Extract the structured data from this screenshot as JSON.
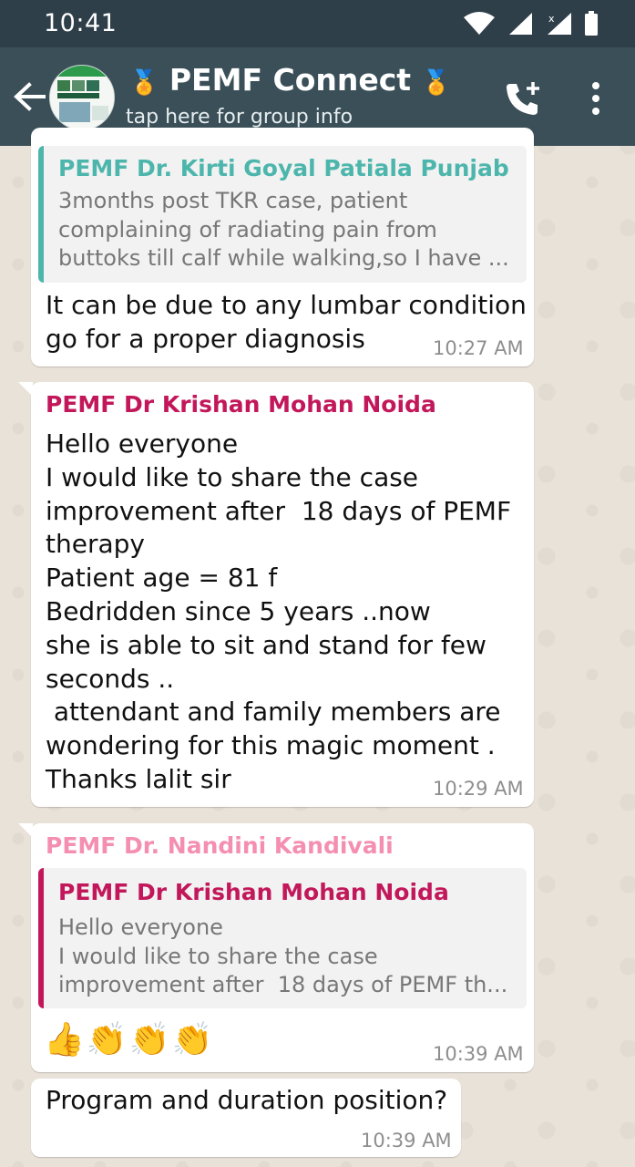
{
  "status_bar": {
    "time": "10:41"
  },
  "header": {
    "title": "PEMF Connect",
    "medal_left": "🏅",
    "medal_right": "🏅",
    "subtitle": "tap here for group info"
  },
  "messages": [
    {
      "quoted_sender": "PEMF Dr. Kirti Goyal Patiala Punjab",
      "quoted_text": "3months post TKR case, patient\ncomplaining of radiating pain from\nbuttoks till calf while walking,so I have ...",
      "text": "It can be due to any lumbar condition\ngo for a proper diagnosis",
      "time": "10:27 AM"
    },
    {
      "sender": "PEMF Dr Krishan Mohan Noida",
      "text": "Hello everyone\nI would like to share the case\nimprovement after  18 days of PEMF\ntherapy\nPatient age = 81 f\nBedridden since 5 years ..now\nshe is able to sit and stand for few\nseconds ..\n attendant and family members are\nwondering for this magic moment .\nThanks lalit sir",
      "time": "10:29 AM"
    },
    {
      "sender": "PEMF Dr. Nandini Kandivali",
      "quoted_sender": "PEMF Dr Krishan Mohan Noida",
      "quoted_text": "Hello everyone\nI would like to share the case\nimprovement after  18 days of PEMF th...",
      "text": "👍👏👏👏",
      "time": "10:39 AM"
    },
    {
      "text": "Program and duration position?",
      "time": "10:39 AM"
    }
  ],
  "colors": {
    "status_bar": "#2f3f49",
    "app_bar": "#3a4f58",
    "kirti": "#4db6ac",
    "krishan": "#c2185b",
    "nandini": "#f48fb1"
  }
}
